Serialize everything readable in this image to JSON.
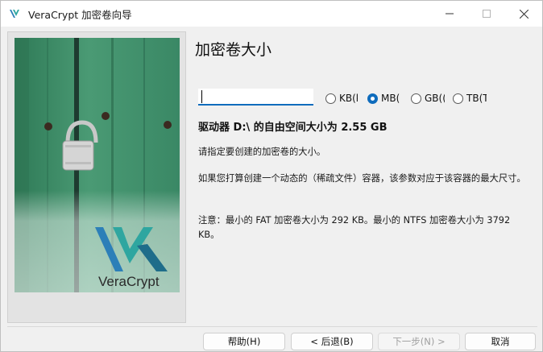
{
  "window": {
    "title": "VeraCrypt 加密卷向导"
  },
  "page": {
    "title": "加密卷大小",
    "size_value": "",
    "units": [
      {
        "label": "KB(k",
        "checked": false
      },
      {
        "label": "MB(",
        "checked": true
      },
      {
        "label": "GB((",
        "checked": false
      },
      {
        "label": "TB(T",
        "checked": false
      }
    ],
    "free_space": "驱动器 D:\\ 的自由空间大小为 2.55 GB",
    "instruction": "请指定要创建的加密卷的大小。",
    "dynamic_note": "如果您打算创建一个动态的（稀疏文件）容器，该参数对应于该容器的最大尺寸。",
    "minimum_note": "注意：最小的 FAT 加密卷大小为 292 KB。最小的 NTFS 加密卷大小为 3792 KB。"
  },
  "side_image": {
    "logo_text": "VeraCrypt"
  },
  "buttons": {
    "help": "帮助(H)",
    "back": "< 后退(B)",
    "next": "下一步(N) >",
    "cancel": "取消"
  },
  "colors": {
    "accent": "#0f6cbd",
    "panel_green": "#3f8f6a",
    "window_bg": "#f0f0f0"
  }
}
